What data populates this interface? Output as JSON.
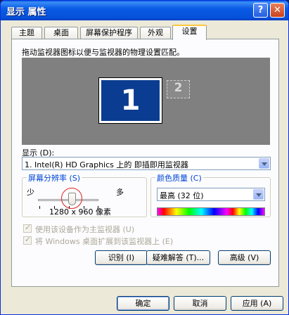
{
  "window": {
    "title": "显示 属性"
  },
  "titlebar_buttons": {
    "help": "?",
    "close": "✕"
  },
  "tabs": [
    {
      "label": "主题"
    },
    {
      "label": "桌面"
    },
    {
      "label": "屏幕保护程序"
    },
    {
      "label": "外观"
    },
    {
      "label": "设置",
      "active": true
    }
  ],
  "settings": {
    "hint": "拖动监视器图标以便与监视器的物理设置匹配。",
    "monitors": [
      {
        "number": "1",
        "selected": true
      },
      {
        "number": "2",
        "selected": false
      }
    ],
    "display_label": "显示 (D):",
    "display_value": "1. Intel(R) HD Graphics 上的 即插即用监视器",
    "resolution": {
      "title": "屏幕分辨率 (S)",
      "less": "少",
      "more": "多",
      "value": "1280 x 960 像素"
    },
    "color_quality": {
      "title": "颜色质量 (C)",
      "value": "最高 (32 位)"
    },
    "checkboxes": [
      {
        "label": "使用该设备作为主监视器 (U)",
        "checked": true,
        "disabled": true
      },
      {
        "label": "将 Windows 桌面扩展到该监视器上 (E)",
        "checked": true,
        "disabled": true
      }
    ],
    "buttons": {
      "identify": "识别 (I)",
      "troubleshoot": "疑难解答 (T)...",
      "advanced": "高级 (V)"
    }
  },
  "footer": {
    "ok": "确定",
    "cancel": "取消",
    "apply": "应用 (A)"
  }
}
